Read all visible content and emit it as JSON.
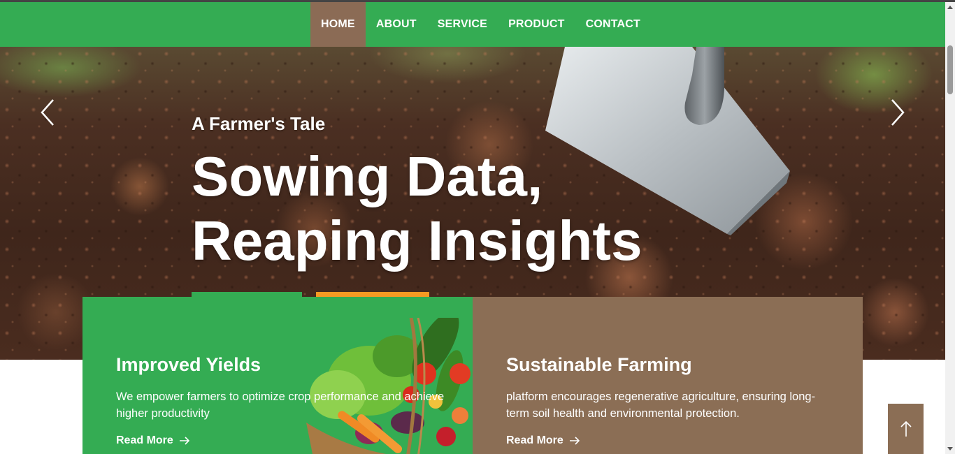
{
  "nav": {
    "items": [
      {
        "label": "HOME",
        "active": true
      },
      {
        "label": "ABOUT",
        "active": false
      },
      {
        "label": "SERVICE",
        "active": false
      },
      {
        "label": "PRODUCT",
        "active": false
      },
      {
        "label": "CONTACT",
        "active": false
      }
    ]
  },
  "hero": {
    "subtitle": "A Farmer's Tale",
    "title": "Sowing Data, Reaping Insights",
    "prev_icon": "chevron-left-icon",
    "next_icon": "chevron-right-icon"
  },
  "features": [
    {
      "title": "Improved Yields",
      "text": "We empower farmers to optimize crop performance and achieve higher productivity",
      "link": "Read More",
      "color": "#34ac53"
    },
    {
      "title": "Sustainable Farming",
      "text": "platform encourages regenerative agriculture, ensuring long-term soil health and environmental protection.",
      "link": "Read More",
      "color": "#8b6e55"
    }
  ],
  "colors": {
    "brand_green": "#34ac53",
    "brand_brown": "#8b6e55",
    "accent_orange": "#f59a23"
  },
  "back_to_top_icon": "arrow-up-icon"
}
